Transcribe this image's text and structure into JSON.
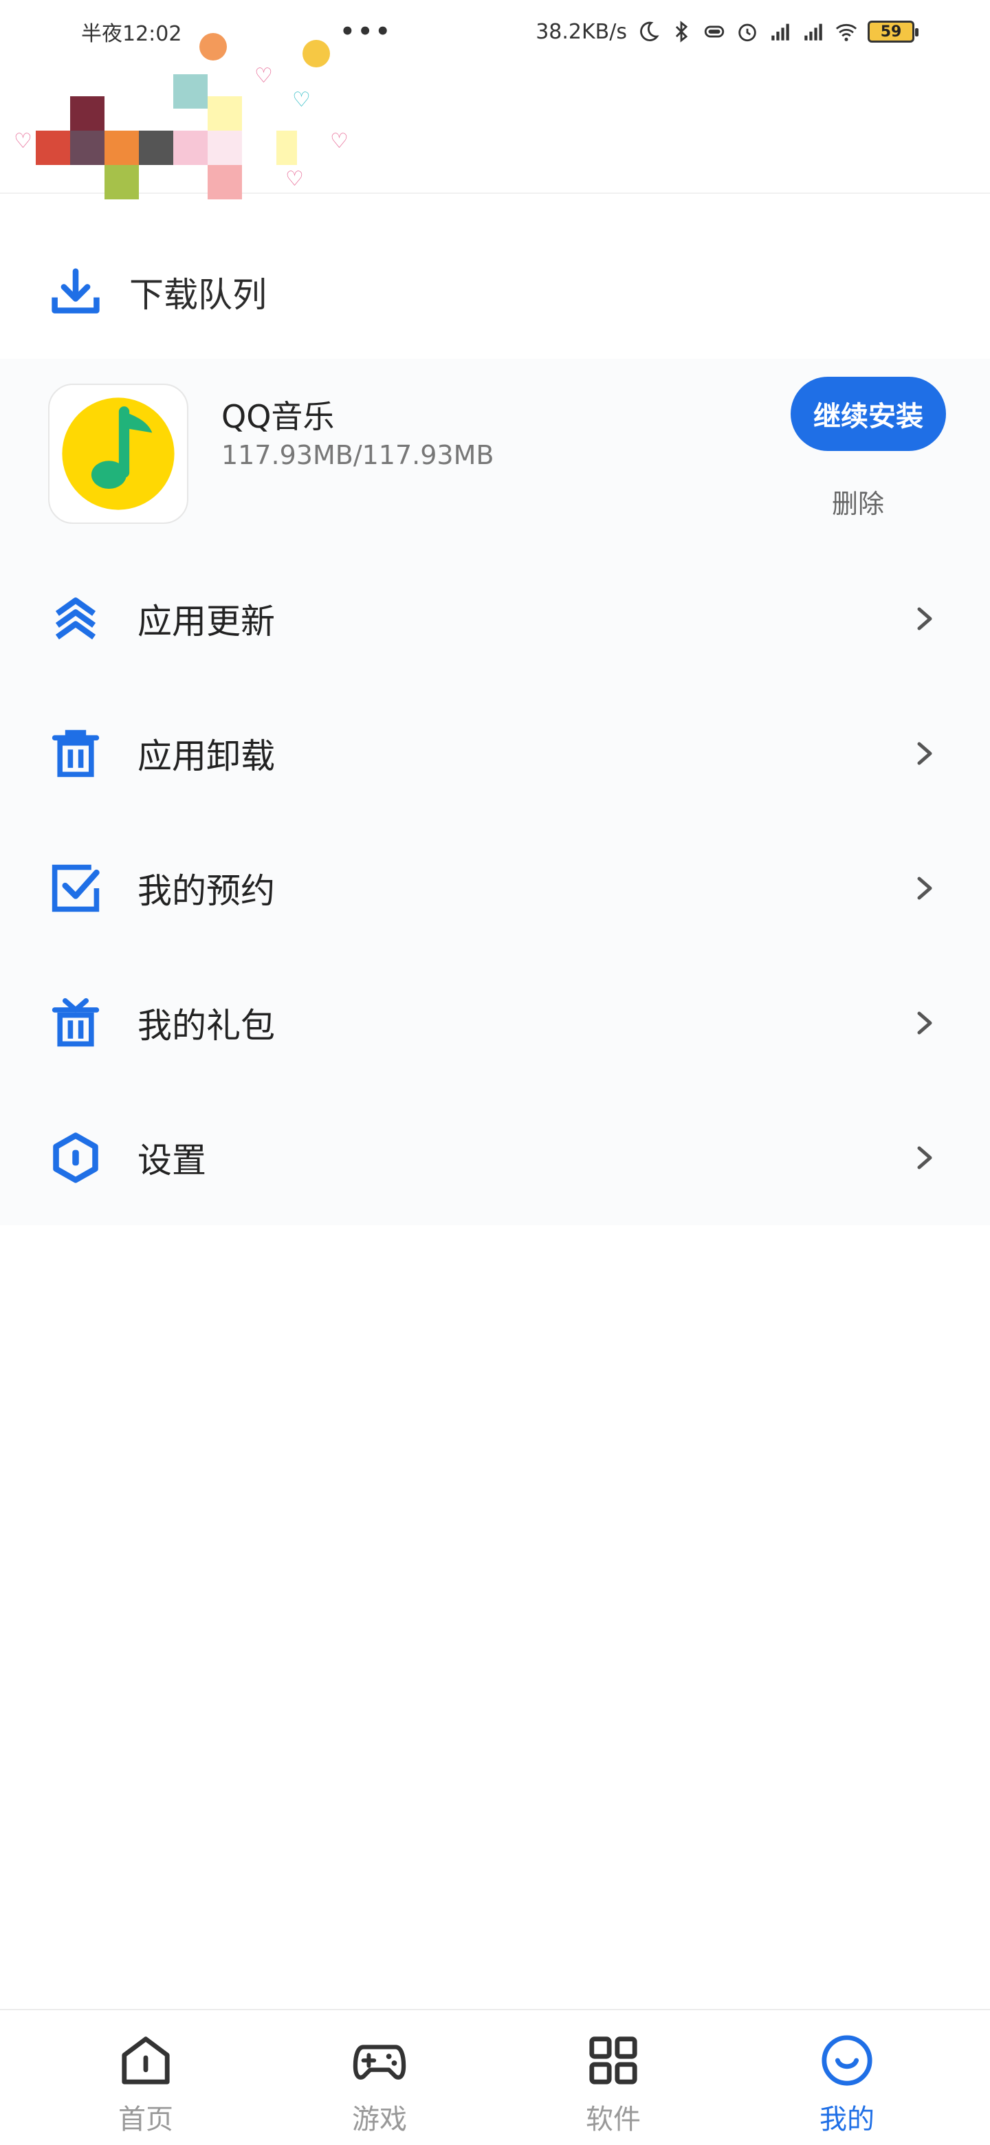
{
  "status_bar": {
    "time": "半夜12:02",
    "more": "•••",
    "network_speed": "38.2KB/s",
    "battery": "59"
  },
  "download_queue": {
    "title": "下载队列",
    "items": [
      {
        "name": "QQ音乐",
        "size": "117.93MB/117.93MB",
        "primary_action": "继续安装",
        "secondary_action": "删除"
      }
    ]
  },
  "menu": [
    {
      "label": "应用更新",
      "icon": "app-update-icon"
    },
    {
      "label": "应用卸载",
      "icon": "trash-icon"
    },
    {
      "label": "我的预约",
      "icon": "checkbox-icon"
    },
    {
      "label": "我的礼包",
      "icon": "gift-icon"
    },
    {
      "label": "设置",
      "icon": "settings-hexagon-icon"
    }
  ],
  "bottom_nav": [
    {
      "label": "首页",
      "icon": "home-icon",
      "active": false
    },
    {
      "label": "游戏",
      "icon": "gamepad-icon",
      "active": false
    },
    {
      "label": "软件",
      "icon": "apps-grid-icon",
      "active": false
    },
    {
      "label": "我的",
      "icon": "smile-icon",
      "active": true
    }
  ],
  "colors": {
    "accent": "#1f6fe6",
    "text_primary": "#222222",
    "text_secondary": "#777777",
    "nav_inactive": "#999999"
  }
}
